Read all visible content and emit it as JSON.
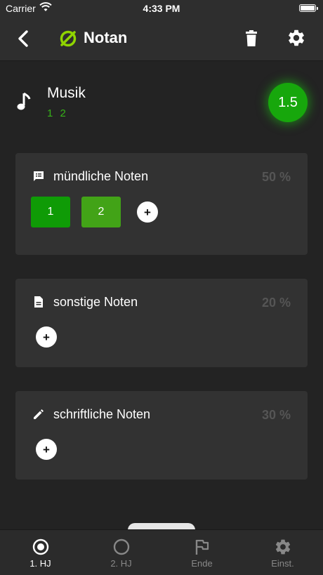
{
  "status_bar": {
    "carrier": "Carrier",
    "time": "4:33 PM"
  },
  "nav": {
    "title": "Notan"
  },
  "subject": {
    "name": "Musik",
    "grades": "1 2",
    "average": "1.5"
  },
  "sections": [
    {
      "title": "mündliche Noten",
      "weight": "50 %",
      "icon": "notes-list-icon",
      "grades": [
        "1",
        "2"
      ],
      "add_label": "+"
    },
    {
      "title": "sonstige Noten",
      "weight": "20 %",
      "icon": "document-icon",
      "grades": [],
      "add_label": "+"
    },
    {
      "title": "schriftliche Noten",
      "weight": "30 %",
      "icon": "pencil-icon",
      "grades": [],
      "add_label": "+"
    }
  ],
  "tabs": [
    {
      "label": "1. HJ",
      "icon": "radio-selected-icon",
      "active": true
    },
    {
      "label": "2. HJ",
      "icon": "radio-empty-icon",
      "active": false
    },
    {
      "label": "Ende",
      "icon": "flag-icon",
      "active": false
    },
    {
      "label": "Einst.",
      "icon": "gear-icon",
      "active": false
    }
  ],
  "colors": {
    "accent": "#17a70c",
    "grade_1": "#0f9b06",
    "grade_2": "#42a317",
    "background": "#232323",
    "card": "#323232"
  }
}
